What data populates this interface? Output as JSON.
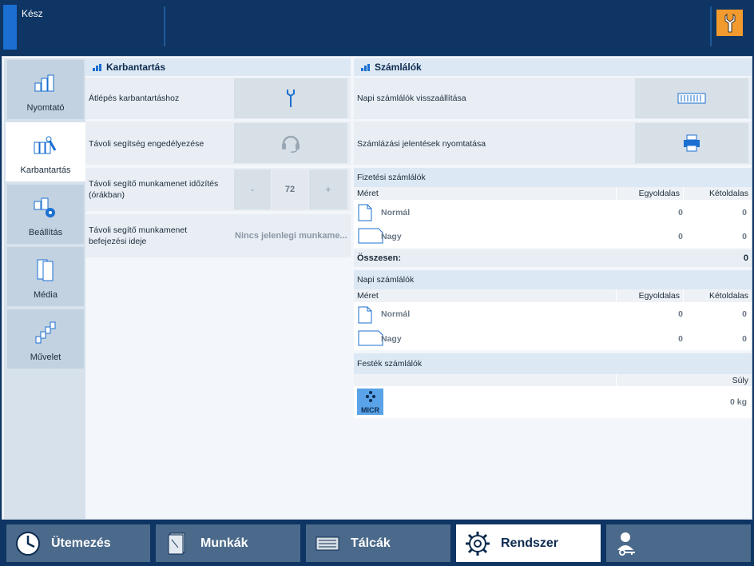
{
  "header": {
    "status": "Kész"
  },
  "sidebar": {
    "items": [
      {
        "label": "Nyomtató"
      },
      {
        "label": "Karbantartás"
      },
      {
        "label": "Beállítás"
      },
      {
        "label": "Média"
      },
      {
        "label": "Művelet"
      }
    ]
  },
  "maintenance": {
    "title": "Karbantartás",
    "rows": [
      {
        "label": "Átlépés karbantartáshoz"
      },
      {
        "label": "Távoli segítség engedélyezése"
      },
      {
        "label": "Távoli segítő munkamenet időzítés (órákban)",
        "minus": "-",
        "value": "72",
        "plus": "+"
      },
      {
        "label": "Távoli segítő munkamenet befejezési ideje",
        "value": "Nincs jelenlegi munkame..."
      }
    ]
  },
  "counters": {
    "title": "Számlálók",
    "reset_label": "Napi számlálók visszaállítása",
    "print_label": "Számlázási jelentések nyomtatása",
    "billing": {
      "title": "Fizetési számlálók",
      "col_size": "Méret",
      "col_simplex": "Egyoldalas",
      "col_duplex": "Kétoldalas",
      "rows": [
        {
          "name": "Normál",
          "simplex": "0",
          "duplex": "0"
        },
        {
          "name": "Nagy",
          "simplex": "0",
          "duplex": "0"
        }
      ],
      "total_label": "Összesen:",
      "total_value": "0"
    },
    "daily": {
      "title": "Napi számlálók",
      "col_size": "Méret",
      "col_simplex": "Egyoldalas",
      "col_duplex": "Kétoldalas",
      "rows": [
        {
          "name": "Normál",
          "simplex": "0",
          "duplex": "0"
        },
        {
          "name": "Nagy",
          "simplex": "0",
          "duplex": "0"
        }
      ]
    },
    "toner": {
      "title": "Festék számlálók",
      "col_weight": "Súly",
      "logo_text": "MICR",
      "value": "0 kg"
    }
  },
  "tabs": [
    {
      "label": "Ütemezés"
    },
    {
      "label": "Munkák"
    },
    {
      "label": "Tálcák"
    },
    {
      "label": "Rendszer"
    },
    {
      "label": ""
    }
  ],
  "colors": {
    "accent": "#1a6fd1",
    "header": "#0e3563",
    "warning": "#f29a2e"
  }
}
